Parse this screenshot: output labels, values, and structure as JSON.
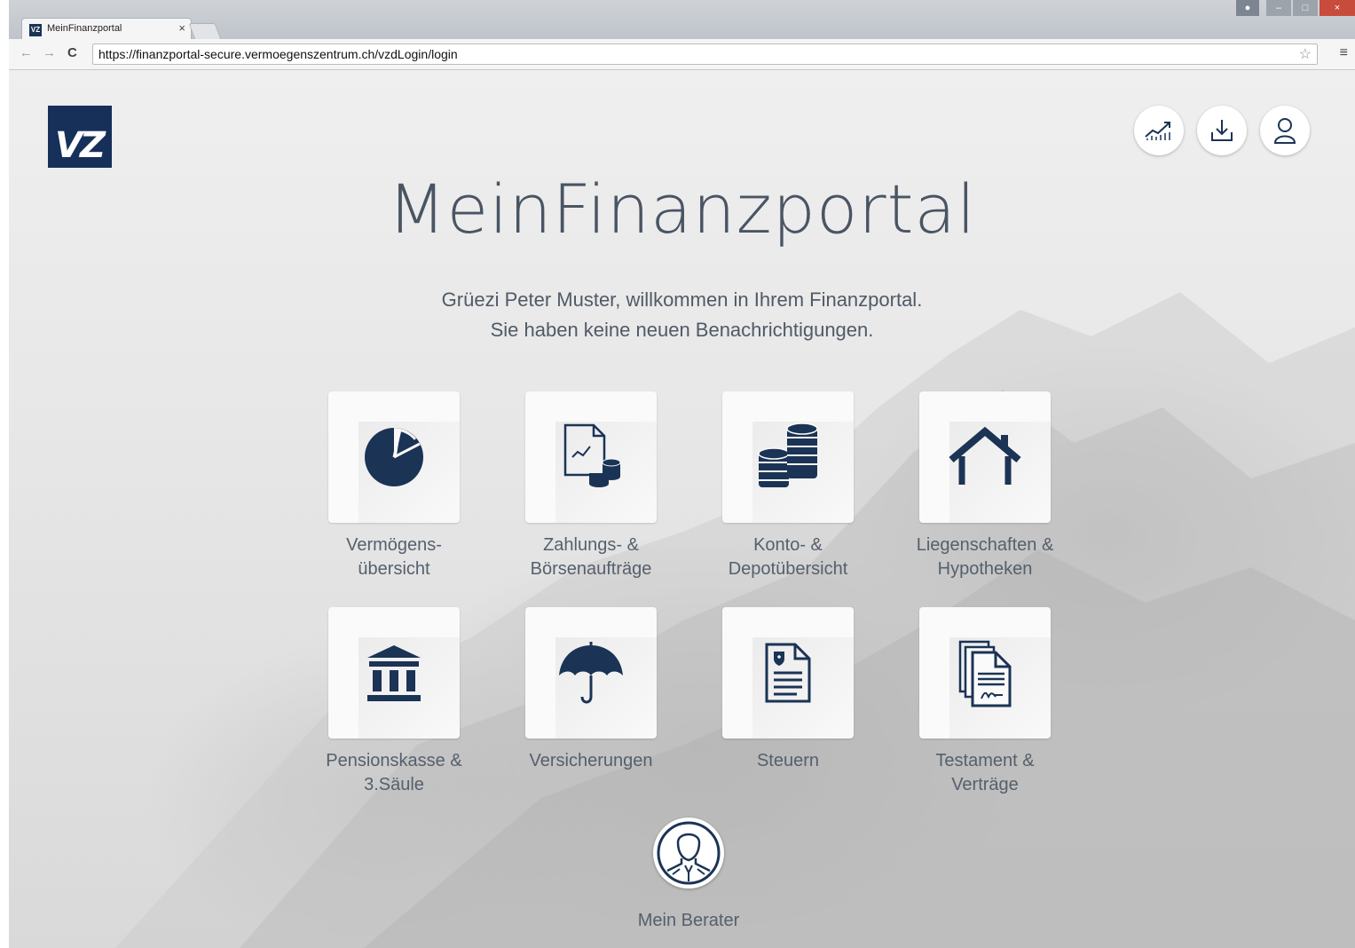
{
  "browser": {
    "tab_title": "MeinFinanzportal",
    "tab_favicon": "VZ",
    "tab_close": "×",
    "url": "https://finanzportal-secure.vermoegenszentrum.ch/vzdLogin/login",
    "back": "←",
    "forward": "→",
    "reload": "C",
    "star": "☆",
    "menu": "≡"
  },
  "page": {
    "logo": "VZ",
    "header_icons": [
      "chart-trend-icon",
      "download-icon",
      "user-icon"
    ],
    "headline": "MeinFinanzportal",
    "greeting_line1": "Grüezi Peter Muster, willkommen in Ihrem Finanzportal.",
    "greeting_line2": "Sie haben keine neuen Benachrichtigungen.",
    "tiles": [
      {
        "line1": "Vermögens-",
        "line2": "übersicht",
        "icon": "pie-chart-icon"
      },
      {
        "line1": "Zahlungs- &",
        "line2": "Börsenaufträge",
        "icon": "document-coins-icon"
      },
      {
        "line1": "Konto- &",
        "line2": "Depotübersicht",
        "icon": "coin-stacks-icon"
      },
      {
        "line1": "Liegenschaften &",
        "line2": "Hypotheken",
        "icon": "house-icon"
      },
      {
        "line1": "Pensionskasse &",
        "line2": "3.Säule",
        "icon": "bank-building-icon"
      },
      {
        "line1": "Versicherungen",
        "line2": "",
        "icon": "umbrella-icon"
      },
      {
        "line1": "Steuern",
        "line2": "",
        "icon": "tax-document-icon"
      },
      {
        "line1": "Testament &",
        "line2": "Verträge",
        "icon": "signed-documents-icon"
      }
    ],
    "advisor_label": "Mein Berater",
    "accent_color": "#1b3355"
  }
}
